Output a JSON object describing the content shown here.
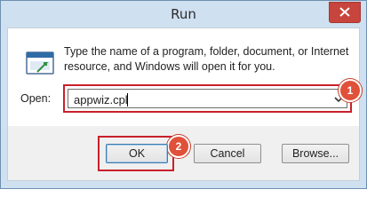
{
  "window": {
    "title": "Run"
  },
  "dialog": {
    "description_line1": "Type the name of a program, folder, document, or Internet",
    "description_line2": "resource, and Windows will open it for you.",
    "open_label": "Open:",
    "open_value": "appwiz.cpl"
  },
  "buttons": {
    "ok": "OK",
    "cancel": "Cancel",
    "browse": "Browse..."
  },
  "annotations": {
    "step1": "1",
    "step2": "2"
  },
  "colors": {
    "highlight": "#c8202b",
    "badge": "#e0513a",
    "close_button": "#c7453c",
    "frame": "#cfe0f1"
  },
  "icons": {
    "run": "run-program-icon",
    "close": "close-icon",
    "dropdown": "chevron-down-icon"
  }
}
